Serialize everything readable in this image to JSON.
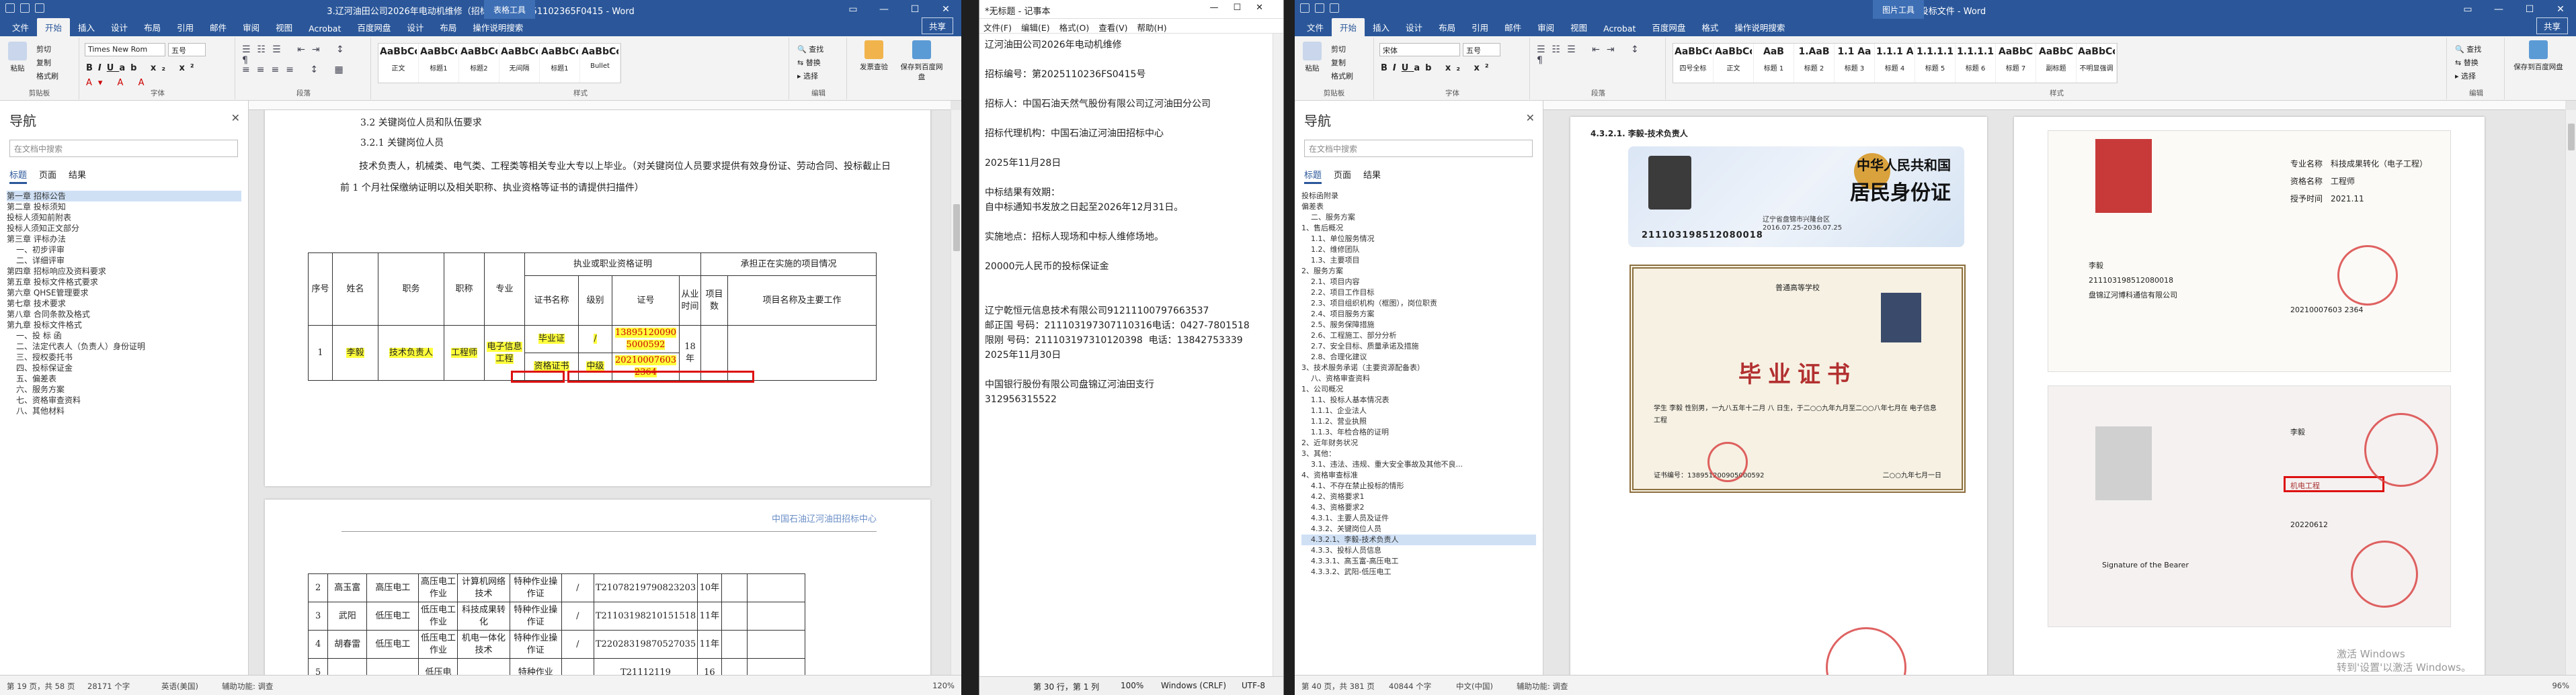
{
  "w1": {
    "title": "3.辽河油田公司2026年电动机维修（招标文件）20251102365F0415 - Word",
    "ctx_tab": "表格工具",
    "tabs": [
      "文件",
      "开始",
      "插入",
      "设计",
      "布局",
      "引用",
      "邮件",
      "审阅",
      "视图",
      "Acrobat",
      "百度网盘",
      "设计",
      "布局",
      "操作说明搜索"
    ],
    "share": "共享",
    "clipboard": {
      "paste": "粘贴",
      "cut": "剪切",
      "copy": "复制",
      "brush": "格式刷",
      "group": "剪贴板"
    },
    "font_name": "Times New Rom",
    "font_size": "五号",
    "font_group": "字体",
    "para_group": "段落",
    "styles": [
      {
        "s": "AaBbCcDc",
        "n": "正文"
      },
      {
        "s": "AaBbCc",
        "n": "标题1"
      },
      {
        "s": "AaBbCcI",
        "n": "标题2"
      },
      {
        "s": "AaBbCcD",
        "n": "无间隔"
      },
      {
        "s": "AaBbCcDi",
        "n": "标题1"
      },
      {
        "s": "AaBbCcDc",
        "n": "Bullet"
      }
    ],
    "styles_group": "样式",
    "edit": {
      "find": "查找",
      "replace": "替换",
      "select": "选择",
      "group": "编辑"
    },
    "tools": [
      {
        "l": "发票查验",
        "n": "发票查验"
      },
      {
        "l": "保存到百度网盘",
        "n": "保存"
      }
    ],
    "nav": {
      "title": "导航",
      "search": "在文档中搜索",
      "tabs": [
        "标题",
        "页面",
        "结果"
      ],
      "items": [
        "第一章 招标公告",
        "第二章 投标须知",
        "投标人须知前附表",
        "投标人须知正文部分",
        "第三章 评标办法",
        "一、初步评审",
        "二、详细评审",
        "第四章 招标响应及资料要求",
        "第五章 投标文件格式要求",
        "第六章 QHSE管理要求",
        "第七章 技术要求",
        "第八章 合同条款及格式",
        "第九章 投标文件格式",
        "一、投 标 函",
        "二、法定代表人（负责人）身份证明",
        "三、授权委托书",
        "四、投标保证金",
        "五、偏差表",
        "六、服务方案",
        "七、资格审查资料",
        "八、其他材料"
      ]
    },
    "doc": {
      "line1": "3.2 关键岗位人员和队伍要求",
      "line2": "3.2.1 关键岗位人员",
      "para": "技术负责人，机械类、电气类、工程类等相关专业大专以上毕业。（对关键岗位人员要求提供有效身份证、劳动合同、投标截止日前 1 个月社保缴纳证明以及相关职称、执业资格等证书的请提供扫描件）",
      "table_header": {
        "no": "序号",
        "name": "姓名",
        "role": "职务",
        "title": "职称",
        "major": "专业",
        "cert_group": "执业或职业资格证明",
        "cert_name": "证书名称",
        "level": "级别",
        "cert_no": "证号",
        "years": "从业时间",
        "proj_group": "承担正在实施的项目情况",
        "proj": "项目数",
        "proj_name": "项目名称及主要工作"
      },
      "row1": {
        "no": "1",
        "name": "李毅",
        "role": "技术负责人",
        "title": "工程师",
        "major": "电子信息工程",
        "cert1": "毕业证",
        "cert2": "资格证书",
        "lvl1": "/",
        "lvl2": "中级",
        "no1": "13895120090 5000592",
        "no2": "20210007603 2364",
        "years": "18年"
      },
      "page2_header": "中国石油辽河油田招标中心",
      "rows": [
        {
          "no": "2",
          "name": "高玉富",
          "role": "高压电工",
          "title": "高压电工作业",
          "major": "计算机网络技术",
          "cert": "特种作业操作证",
          "lvl": "/",
          "cno": "T21078219790823203",
          "yrs": "10年"
        },
        {
          "no": "3",
          "name": "武阳",
          "role": "低压电工",
          "title": "低压电工作业",
          "major": "科技成果转化",
          "cert": "特种作业操作证",
          "lvl": "/",
          "cno": "T21103198210151518",
          "yrs": "11年"
        },
        {
          "no": "4",
          "name": "胡春雷",
          "role": "低压电工",
          "title": "低压电工作业",
          "major": "机电一体化技术",
          "cert": "特种作业操作证",
          "lvl": "/",
          "cno": "T22028319870527035",
          "yrs": "11年"
        },
        {
          "no": "5",
          "name": "",
          "role": "",
          "title": "低压电",
          "major": "",
          "cert": "特种作业",
          "lvl": "",
          "cno": "T21112119",
          "yrs": "16"
        }
      ]
    },
    "status": {
      "page": "第 19 页，共 58 页",
      "words": "28171 个字",
      "lang": "英语(美国)",
      "acc": "辅助功能: 调查",
      "zoom": "120%"
    }
  },
  "w2": {
    "title": "*无标题 - 记事本",
    "menu": [
      "文件(F)",
      "编辑(E)",
      "格式(O)",
      "查看(V)",
      "帮助(H)"
    ],
    "lines": [
      "辽河油田公司2026年电动机维修",
      "",
      "招标编号：第2025110236FS0415号",
      "",
      "招标人：中国石油天然气股份有限公司辽河油田分公司",
      "",
      "招标代理机构：中国石油辽河油田招标中心",
      "",
      "2025年11月28日",
      "",
      "中标结果有效期：",
      "自中标通知书发放之日起至2026年12月31日。",
      "",
      "实施地点：招标人现场和中标人维修场地。",
      "",
      "20000元人民币的投标保证金",
      "",
      "",
      "辽宁乾恒元信息技术有限公司91211100797663537",
      "邮正国 号码：211103197307110316电话：0427-7801518",
      "限刚 号码：211103197310120398  电话：13842753339",
      "2025年11月30日",
      "",
      "中国银行股份有限公司盘锦辽河油田支行",
      "312956315522"
    ],
    "status": {
      "pos": "第 30 行，第 1 列",
      "zoom": "100%",
      "eol": "Windows (CRLF)",
      "enc": "UTF-8"
    }
  },
  "w3": {
    "title": "韩熙乐 - 投标文件 - Word",
    "ctx_tab": "图片工具",
    "tabs": [
      "文件",
      "开始",
      "插入",
      "设计",
      "布局",
      "引用",
      "邮件",
      "审阅",
      "视图",
      "Acrobat",
      "百度网盘",
      "格式",
      "操作说明搜索"
    ],
    "share": "共享",
    "font_name": "宋体",
    "font_size": "五号",
    "styles": [
      {
        "s": "AaBbCc",
        "n": "四号全标"
      },
      {
        "s": "AaBbCcDd",
        "n": "正文"
      },
      {
        "s": "AaB",
        "n": "标题 1"
      },
      {
        "s": "1.AaB",
        "n": "标题 2"
      },
      {
        "s": "1.1 Aa",
        "n": "标题 3"
      },
      {
        "s": "1.1.1 A",
        "n": "标题 4"
      },
      {
        "s": "1.1.1.1",
        "n": "标题 5"
      },
      {
        "s": "1.1.1.1",
        "n": "标题 6"
      },
      {
        "s": "AaBbC",
        "n": "标题 7"
      },
      {
        "s": "AaBbC",
        "n": "副标题"
      },
      {
        "s": "AaBbCcD",
        "n": "不明显强调"
      }
    ],
    "nav": {
      "title": "导航",
      "search": "在文档中搜索",
      "tabs": [
        "标题",
        "页面",
        "结果"
      ],
      "items": [
        "投标函附录",
        "偏差表",
        "二、服务方案",
        "1、售后概况",
        "1.1、单位服务情况",
        "1.2、维修团队",
        "1.3、主要项目",
        "2、服务方案",
        "2.1、项目内容",
        "2.2、项目工作目标",
        "2.3、项目组织机构（框图），岗位职责",
        "2.4、项目服务方案",
        "2.5、服务保障措施",
        "2.6、工程施工、部分分析",
        "2.7、安全目标、质量承诺及措施",
        "2.8、合理化建议",
        "3、技术服务承诺（主要资源配备表）",
        "八、资格审查资料",
        "1、公司概况",
        "1.1、投标人基本情况表",
        "1.1.1、企业法人",
        "1.1.2、营业执照",
        "1.1.3、年检合格的证明",
        "2、近年财务状况",
        "3、其他：",
        "3.1、违法、违规、重大安全事故及其他不良...",
        "4、资格审查标准",
        "4.1、不存在禁止投标的情形",
        "4.2、资格要求1",
        "4.3、资格要求2",
        "4.3.1、主要人员及证件",
        "4.3.2、关键岗位人员",
        "4.3.2.1、李毅-技术负责人",
        "4.3.3、投标人员信息",
        "4.3.3.1、高玉富-高压电工",
        "4.3.3.2、武阳-低压电工"
      ]
    },
    "doc": {
      "heading": "4.3.2.1. 李毅-技术负责人",
      "id_title": "中华人民共和国",
      "id_sub": "居民身份证",
      "id_number": "211103198512080018",
      "id_authority": "辽宁省盘锦市兴隆台区",
      "id_valid": "2016.07.25-2036.07.25",
      "dip_school": "普通高等学校",
      "dip_title": "毕业证书",
      "dip_line": "学生 李毅  性别男，一九八五年十二月 八 日生，于二○○九年九月至二○○八年七月在 电子信息工程",
      "dip_no": "证书编号：138951200905000592",
      "dip_date": "二○○九年七月一日",
      "cert_major": "专业名称",
      "cert_major_v": "科技成果转化（电子工程）",
      "cert_level": "资格名称",
      "cert_level_v": "工程师",
      "cert_date": "授予时间",
      "cert_date_v": "2021.11",
      "cert_name": "李毅",
      "cert_idno": "211103198512080018",
      "cert_unit": "盘锦辽河博科通信有限公司",
      "cert_no": "20210007603 2364",
      "op_prof": "机电工程",
      "op_date": "20220612",
      "op_full": "李毅",
      "op_bearer": "Signature of the Bearer"
    },
    "status": {
      "page": "第 40 页，共 381 页",
      "words": "40844 个字",
      "lang": "中文(中国)",
      "acc": "辅助功能: 调查",
      "zoom": "96%"
    },
    "watermark": "激活 Windows\n转到'设置'以激活 Windows。"
  },
  "colors": {
    "word_blue": "#2b579a",
    "highlight": "#ffff3c",
    "red": "#d11111"
  }
}
